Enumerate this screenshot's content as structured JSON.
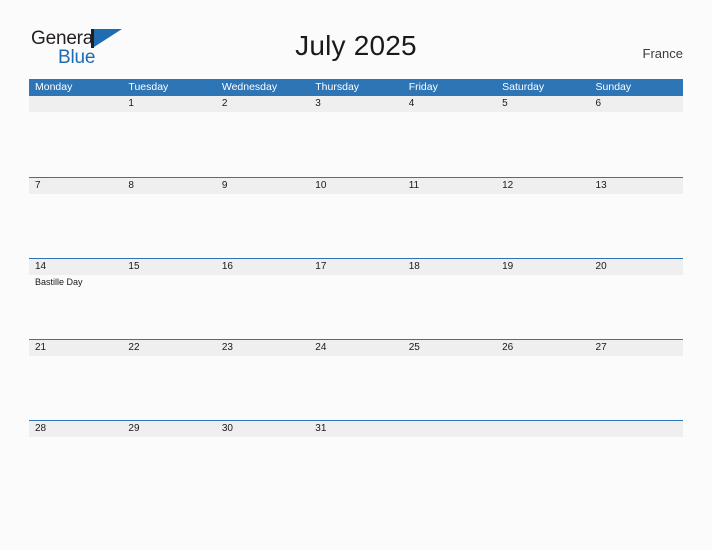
{
  "logo": {
    "word_one": "General",
    "word_two": "Blue",
    "triangle_icon": "triangle-icon",
    "brand_blue": "#1f6cb0"
  },
  "header": {
    "title": "July 2025",
    "country": "France"
  },
  "colors": {
    "header_blue": "#2e75b6",
    "band_gray": "#efefef",
    "page_bg": "#fbfbfc",
    "text": "#1a1a1a"
  },
  "calendar": {
    "month": "July",
    "year": "2025",
    "weekdays": [
      "Monday",
      "Tuesday",
      "Wednesday",
      "Thursday",
      "Friday",
      "Saturday",
      "Sunday"
    ],
    "weeks": [
      [
        {
          "day": "",
          "event": ""
        },
        {
          "day": "1",
          "event": ""
        },
        {
          "day": "2",
          "event": ""
        },
        {
          "day": "3",
          "event": ""
        },
        {
          "day": "4",
          "event": ""
        },
        {
          "day": "5",
          "event": ""
        },
        {
          "day": "6",
          "event": ""
        }
      ],
      [
        {
          "day": "7",
          "event": ""
        },
        {
          "day": "8",
          "event": ""
        },
        {
          "day": "9",
          "event": ""
        },
        {
          "day": "10",
          "event": ""
        },
        {
          "day": "11",
          "event": ""
        },
        {
          "day": "12",
          "event": ""
        },
        {
          "day": "13",
          "event": ""
        }
      ],
      [
        {
          "day": "14",
          "event": "Bastille Day"
        },
        {
          "day": "15",
          "event": ""
        },
        {
          "day": "16",
          "event": ""
        },
        {
          "day": "17",
          "event": ""
        },
        {
          "day": "18",
          "event": ""
        },
        {
          "day": "19",
          "event": ""
        },
        {
          "day": "20",
          "event": ""
        }
      ],
      [
        {
          "day": "21",
          "event": ""
        },
        {
          "day": "22",
          "event": ""
        },
        {
          "day": "23",
          "event": ""
        },
        {
          "day": "24",
          "event": ""
        },
        {
          "day": "25",
          "event": ""
        },
        {
          "day": "26",
          "event": ""
        },
        {
          "day": "27",
          "event": ""
        }
      ],
      [
        {
          "day": "28",
          "event": ""
        },
        {
          "day": "29",
          "event": ""
        },
        {
          "day": "30",
          "event": ""
        },
        {
          "day": "31",
          "event": ""
        },
        {
          "day": "",
          "event": ""
        },
        {
          "day": "",
          "event": ""
        },
        {
          "day": "",
          "event": ""
        }
      ]
    ]
  }
}
